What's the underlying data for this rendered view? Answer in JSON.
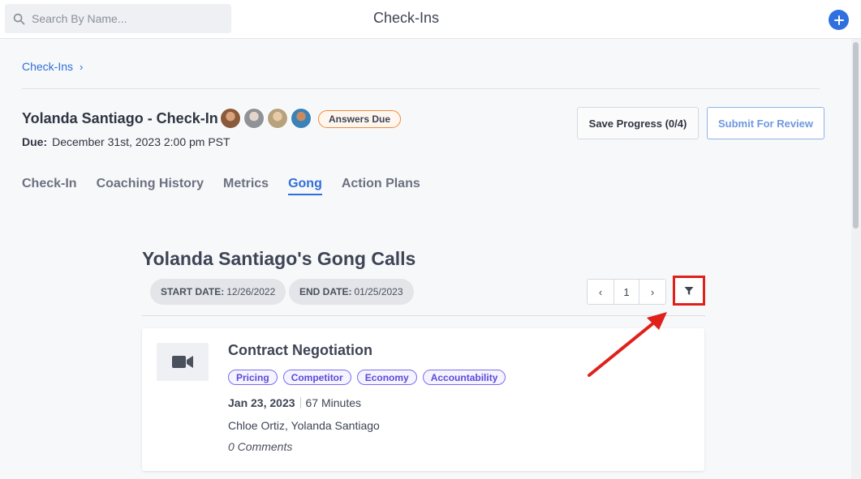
{
  "topbar": {
    "search_placeholder": "Search By Name...",
    "title": "Check-Ins",
    "add_icon": "plus-icon"
  },
  "breadcrumb": {
    "items": [
      "Check-Ins"
    ],
    "separator_icon": "chevron-right-icon"
  },
  "checkin": {
    "title": "Yolanda Santiago - Check-In",
    "status_badge": "Answers Due",
    "due_label": "Due:",
    "due_value": "December 31st, 2023 2:00 pm PST",
    "save_button": "Save Progress (0/4)",
    "submit_button": "Submit For Review"
  },
  "tabs": [
    {
      "label": "Check-In",
      "active": false
    },
    {
      "label": "Coaching History",
      "active": false
    },
    {
      "label": "Metrics",
      "active": false
    },
    {
      "label": "Gong",
      "active": true
    },
    {
      "label": "Action Plans",
      "active": false
    }
  ],
  "gong": {
    "title": "Yolanda Santiago's Gong Calls",
    "start_label": "START DATE:",
    "start_value": "12/26/2022",
    "end_label": "END DATE:",
    "end_value": "01/25/2023",
    "pager": {
      "prev": "‹",
      "page": "1",
      "next": "›"
    },
    "filter_icon": "filter-icon",
    "calls": [
      {
        "icon": "video-camera-icon",
        "title": "Contract Negotiation",
        "tags": [
          "Pricing",
          "Competitor",
          "Economy",
          "Accountability"
        ],
        "date": "Jan 23, 2023",
        "duration": "67 Minutes",
        "participants": "Chloe Ortiz, Yolanda Santiago",
        "comments": "0 Comments"
      }
    ]
  },
  "colors": {
    "accent": "#2f6fd9",
    "badge_border": "#f08a3c",
    "tag_border": "#7b6cf0",
    "highlight": "#e0201b"
  }
}
